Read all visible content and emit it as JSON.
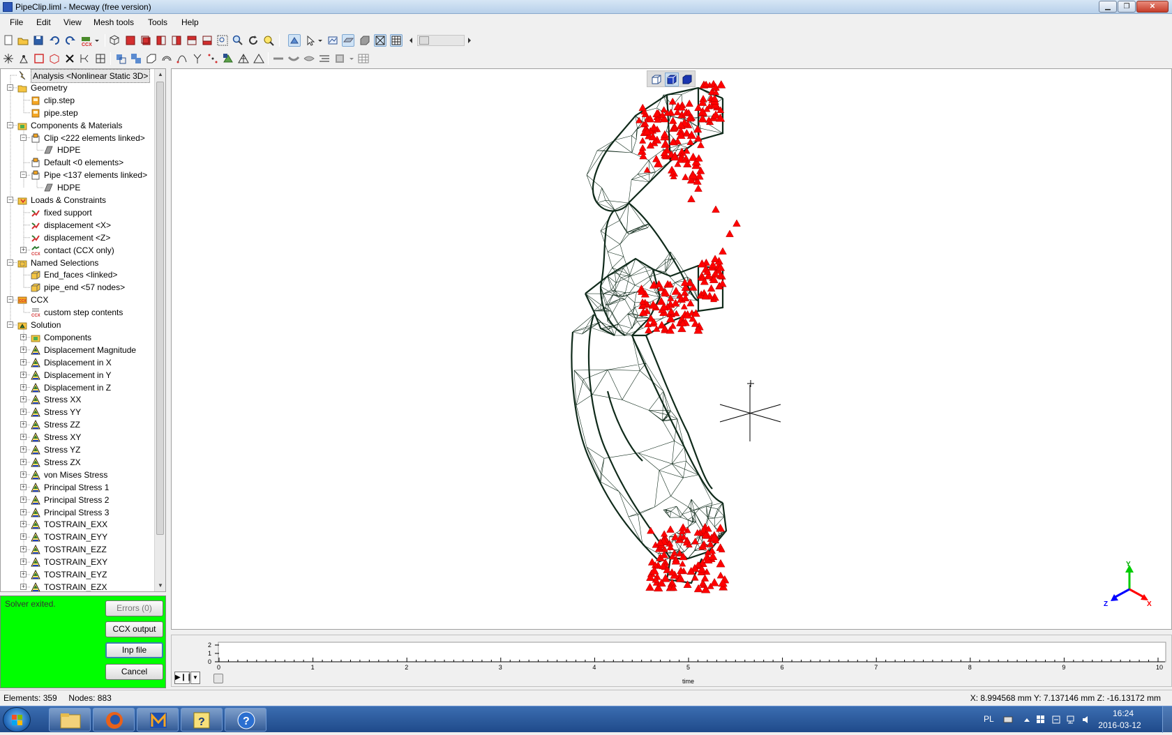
{
  "window": {
    "title": "PipeClip.liml - Mecway (free version)"
  },
  "menu": [
    "File",
    "Edit",
    "View",
    "Mesh tools",
    "Tools",
    "Help"
  ],
  "tree": [
    {
      "label": "Analysis <Nonlinear Static 3D>",
      "level": 1,
      "icon": "analysis-icon",
      "expander": "",
      "selected": true
    },
    {
      "label": "Geometry",
      "level": 1,
      "icon": "folder-icon",
      "expander": "−"
    },
    {
      "label": "clip.step",
      "level": 2,
      "icon": "step-file-icon",
      "expander": ""
    },
    {
      "label": "pipe.step",
      "level": 2,
      "icon": "step-file-icon",
      "expander": ""
    },
    {
      "label": "Components & Materials",
      "level": 1,
      "icon": "components-icon",
      "expander": "−"
    },
    {
      "label": "Clip <222 elements linked>",
      "level": 2,
      "icon": "component-icon",
      "expander": "−"
    },
    {
      "label": "HDPE",
      "level": 3,
      "icon": "material-icon",
      "expander": ""
    },
    {
      "label": "Default <0 elements>",
      "level": 2,
      "icon": "component-icon",
      "expander": ""
    },
    {
      "label": "Pipe <137 elements linked>",
      "level": 2,
      "icon": "component-icon",
      "expander": "−"
    },
    {
      "label": "HDPE",
      "level": 3,
      "icon": "material-icon",
      "expander": ""
    },
    {
      "label": "Loads & Constraints",
      "level": 1,
      "icon": "loads-icon",
      "expander": "−"
    },
    {
      "label": "fixed support",
      "level": 2,
      "icon": "support-icon",
      "expander": ""
    },
    {
      "label": "displacement <X>",
      "level": 2,
      "icon": "displacement-icon",
      "expander": ""
    },
    {
      "label": "displacement <Z>",
      "level": 2,
      "icon": "displacement-icon",
      "expander": ""
    },
    {
      "label": "contact (CCX only)",
      "level": 2,
      "icon": "contact-icon",
      "expander": "+"
    },
    {
      "label": "Named Selections",
      "level": 1,
      "icon": "selection-folder-icon",
      "expander": "−"
    },
    {
      "label": "End_faces <linked>",
      "level": 2,
      "icon": "selection-icon",
      "expander": ""
    },
    {
      "label": "pipe_end <57 nodes>",
      "level": 2,
      "icon": "selection-icon",
      "expander": ""
    },
    {
      "label": "CCX",
      "level": 1,
      "icon": "ccx-icon",
      "expander": "−"
    },
    {
      "label": "custom step contents",
      "level": 2,
      "icon": "ccx-step-icon",
      "expander": ""
    },
    {
      "label": "Solution",
      "level": 1,
      "icon": "solution-icon",
      "expander": "−"
    },
    {
      "label": "Components",
      "level": 2,
      "icon": "components-icon",
      "expander": "+"
    },
    {
      "label": "Displacement Magnitude",
      "level": 2,
      "icon": "result-icon",
      "expander": "+"
    },
    {
      "label": "Displacement in X",
      "level": 2,
      "icon": "result-icon",
      "expander": "+"
    },
    {
      "label": "Displacement in Y",
      "level": 2,
      "icon": "result-icon",
      "expander": "+"
    },
    {
      "label": "Displacement in Z",
      "level": 2,
      "icon": "result-icon",
      "expander": "+"
    },
    {
      "label": "Stress XX",
      "level": 2,
      "icon": "result-icon",
      "expander": "+"
    },
    {
      "label": "Stress YY",
      "level": 2,
      "icon": "result-icon",
      "expander": "+"
    },
    {
      "label": "Stress ZZ",
      "level": 2,
      "icon": "result-icon",
      "expander": "+"
    },
    {
      "label": "Stress XY",
      "level": 2,
      "icon": "result-icon",
      "expander": "+"
    },
    {
      "label": "Stress YZ",
      "level": 2,
      "icon": "result-icon",
      "expander": "+"
    },
    {
      "label": "Stress ZX",
      "level": 2,
      "icon": "result-icon",
      "expander": "+"
    },
    {
      "label": "von Mises Stress",
      "level": 2,
      "icon": "result-icon",
      "expander": "+"
    },
    {
      "label": "Principal Stress 1",
      "level": 2,
      "icon": "result-icon",
      "expander": "+"
    },
    {
      "label": "Principal Stress 2",
      "level": 2,
      "icon": "result-icon",
      "expander": "+"
    },
    {
      "label": "Principal Stress 3",
      "level": 2,
      "icon": "result-icon",
      "expander": "+"
    },
    {
      "label": "TOSTRAIN_EXX",
      "level": 2,
      "icon": "result-icon",
      "expander": "+"
    },
    {
      "label": "TOSTRAIN_EYY",
      "level": 2,
      "icon": "result-icon",
      "expander": "+"
    },
    {
      "label": "TOSTRAIN_EZZ",
      "level": 2,
      "icon": "result-icon",
      "expander": "+"
    },
    {
      "label": "TOSTRAIN_EXY",
      "level": 2,
      "icon": "result-icon",
      "expander": "+"
    },
    {
      "label": "TOSTRAIN_EYZ",
      "level": 2,
      "icon": "result-icon",
      "expander": "+"
    },
    {
      "label": "TOSTRAIN_EZX",
      "level": 2,
      "icon": "result-icon",
      "expander": "+"
    }
  ],
  "solver": {
    "status": "Solver exited.",
    "errors_label": "Errors (0)",
    "ccx_output_label": "CCX output",
    "inp_file_label": "Inp file",
    "cancel_label": "Cancel",
    "background_color": "#00ff00"
  },
  "timeline": {
    "y_ticks": [
      "2",
      "1",
      "0"
    ],
    "x_ticks": [
      "0",
      "1",
      "2",
      "3",
      "4",
      "5",
      "6",
      "7",
      "8",
      "9",
      "10"
    ],
    "xlabel": "time"
  },
  "axis_triad": {
    "x": "X",
    "y": "Y",
    "z": "Z"
  },
  "status": {
    "elements_label": "Elements:",
    "elements": "359",
    "nodes_label": "Nodes:",
    "nodes": "883",
    "coordinates": "X: 8.994568 mm Y: 7.137146 mm Z: -16.13172 mm"
  },
  "taskbar": {
    "language": "PL",
    "time": "16:24",
    "date": "2016-03-12",
    "apps": [
      "start-button",
      "file-explorer",
      "firefox",
      "mecway",
      "help-viewer",
      "help"
    ]
  },
  "colors": {
    "mesh": "#0f2a1a",
    "constraint_markers": "#ff0000",
    "solver_ok": "#00ff00",
    "axis_x": "#ff0000",
    "axis_y": "#00cc00",
    "axis_z": "#0000ff"
  }
}
